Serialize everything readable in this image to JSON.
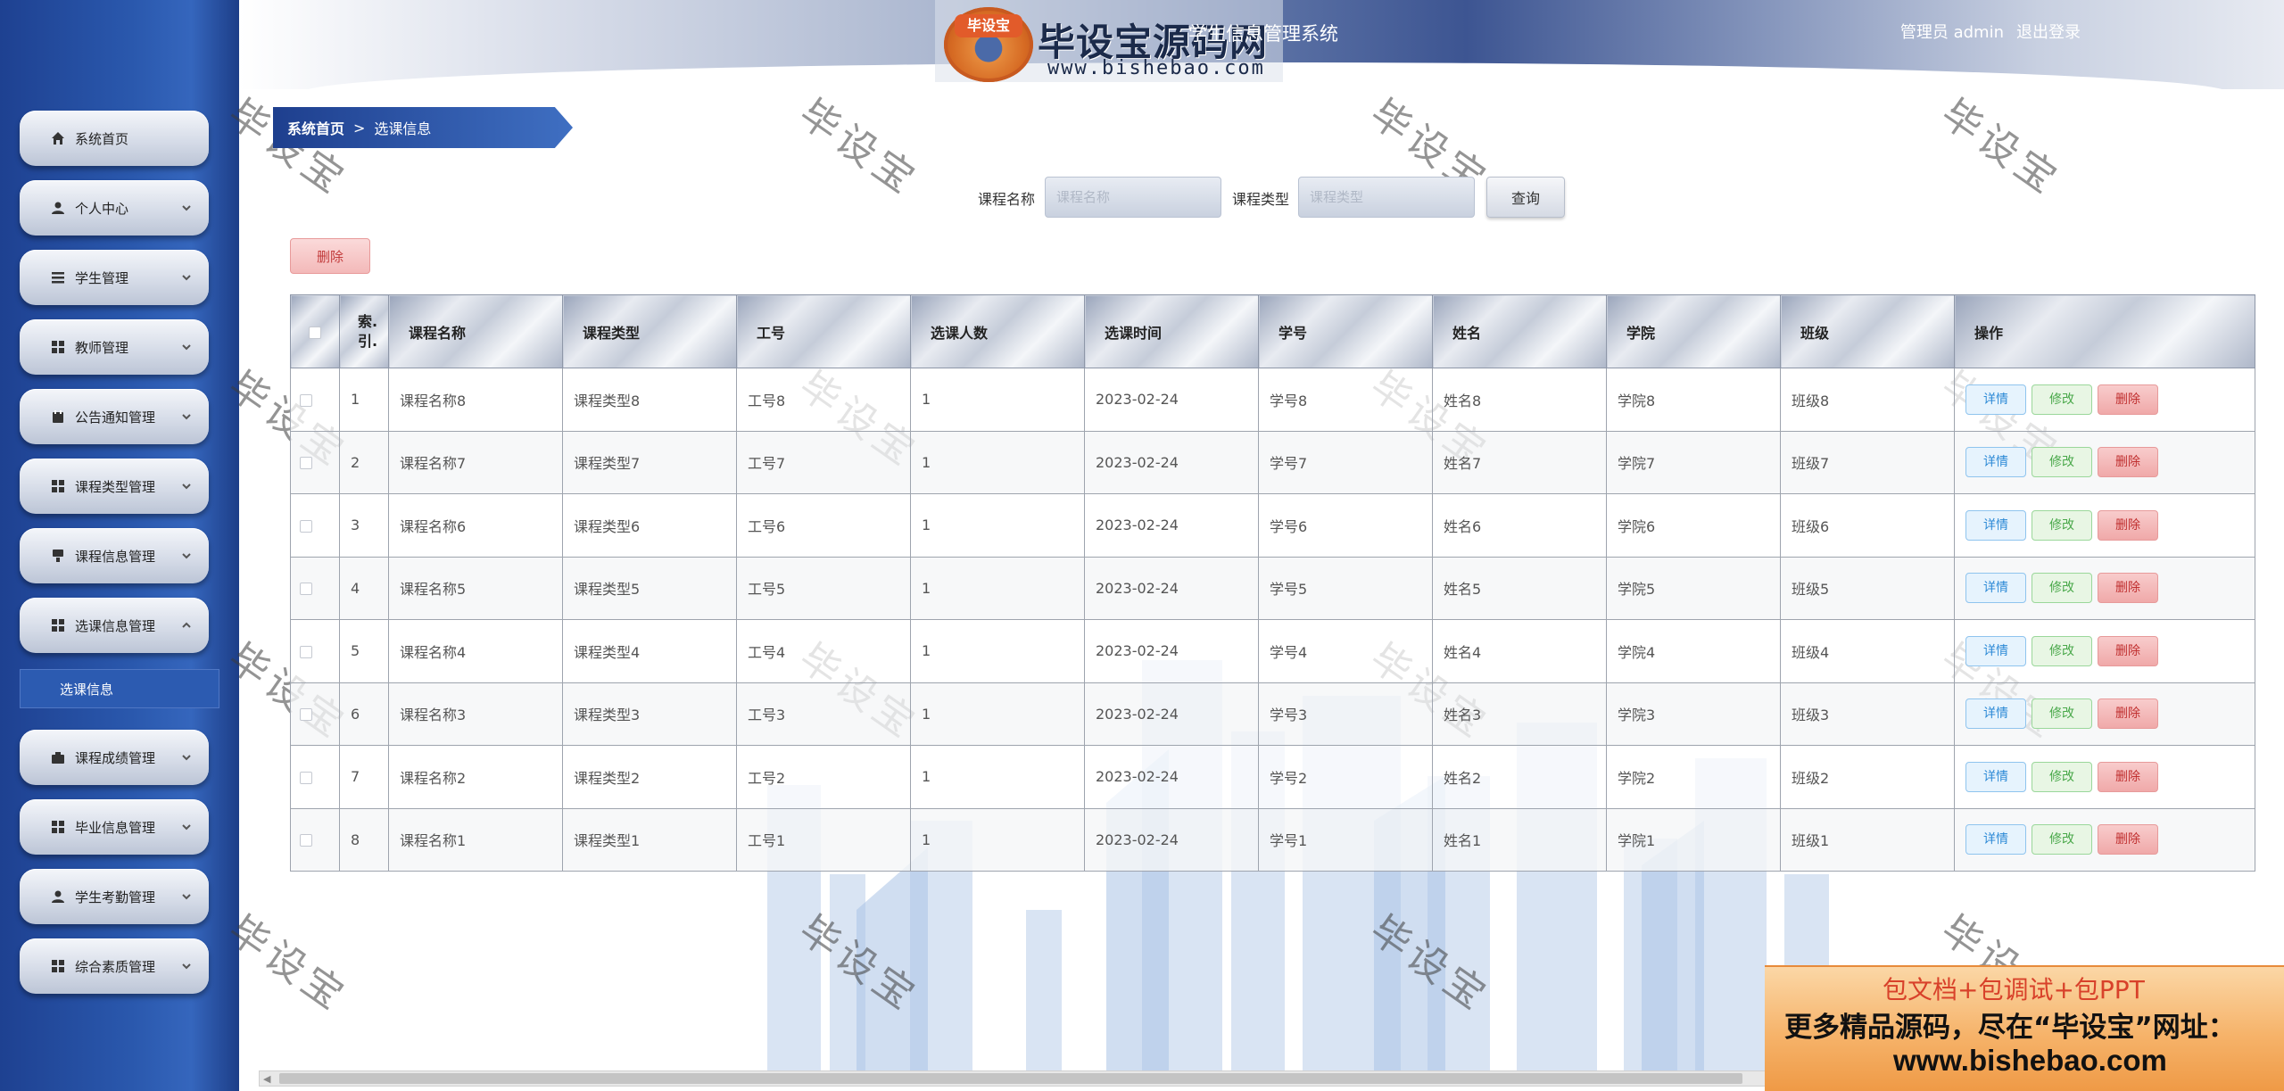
{
  "header": {
    "logo_badge": "毕设宝",
    "logo_title": "毕设宝源码网",
    "logo_url": "www.bishebao.com",
    "system_title": "学生信息管理系统",
    "user_role_label": "管理员 admin",
    "logout_label": "退出登录"
  },
  "sidebar": {
    "items": [
      {
        "label": "系统首页",
        "icon": "home-icon"
      },
      {
        "label": "个人中心",
        "icon": "user-icon"
      },
      {
        "label": "学生管理",
        "icon": "list-icon"
      },
      {
        "label": "教师管理",
        "icon": "grid-icon"
      },
      {
        "label": "公告通知管理",
        "icon": "calendar-icon"
      },
      {
        "label": "课程类型管理",
        "icon": "grid-icon"
      },
      {
        "label": "课程信息管理",
        "icon": "monitor-icon"
      },
      {
        "label": "选课信息管理",
        "icon": "grid-icon"
      },
      {
        "label": "课程成绩管理",
        "icon": "briefcase-icon"
      },
      {
        "label": "毕业信息管理",
        "icon": "grid-icon"
      },
      {
        "label": "学生考勤管理",
        "icon": "user-icon"
      },
      {
        "label": "综合素质管理",
        "icon": "grid-icon"
      }
    ],
    "active_sub_item": "选课信息"
  },
  "breadcrumb": {
    "home": "系统首页",
    "separator": ">",
    "current": "选课信息"
  },
  "search": {
    "course_name_label": "课程名称",
    "course_name_placeholder": "课程名称",
    "course_type_label": "课程类型",
    "course_type_placeholder": "课程类型",
    "query_button": "查询"
  },
  "toolbar": {
    "delete_label": "删除"
  },
  "table": {
    "columns": [
      "",
      "索引",
      "课程名称",
      "课程类型",
      "工号",
      "选课人数",
      "选课时间",
      "学号",
      "姓名",
      "学院",
      "班级",
      "操作"
    ],
    "index_header_line1": "索.",
    "index_header_line2": "引.",
    "rows": [
      {
        "index": "1",
        "course_name": "课程名称8",
        "course_type": "课程类型8",
        "job_no": "工号8",
        "count": "1",
        "time": "2023-02-24",
        "student_no": "学号8",
        "name": "姓名8",
        "college": "学院8",
        "class": "班级8"
      },
      {
        "index": "2",
        "course_name": "课程名称7",
        "course_type": "课程类型7",
        "job_no": "工号7",
        "count": "1",
        "time": "2023-02-24",
        "student_no": "学号7",
        "name": "姓名7",
        "college": "学院7",
        "class": "班级7"
      },
      {
        "index": "3",
        "course_name": "课程名称6",
        "course_type": "课程类型6",
        "job_no": "工号6",
        "count": "1",
        "time": "2023-02-24",
        "student_no": "学号6",
        "name": "姓名6",
        "college": "学院6",
        "class": "班级6"
      },
      {
        "index": "4",
        "course_name": "课程名称5",
        "course_type": "课程类型5",
        "job_no": "工号5",
        "count": "1",
        "time": "2023-02-24",
        "student_no": "学号5",
        "name": "姓名5",
        "college": "学院5",
        "class": "班级5"
      },
      {
        "index": "5",
        "course_name": "课程名称4",
        "course_type": "课程类型4",
        "job_no": "工号4",
        "count": "1",
        "time": "2023-02-24",
        "student_no": "学号4",
        "name": "姓名4",
        "college": "学院4",
        "class": "班级4"
      },
      {
        "index": "6",
        "course_name": "课程名称3",
        "course_type": "课程类型3",
        "job_no": "工号3",
        "count": "1",
        "time": "2023-02-24",
        "student_no": "学号3",
        "name": "姓名3",
        "college": "学院3",
        "class": "班级3"
      },
      {
        "index": "7",
        "course_name": "课程名称2",
        "course_type": "课程类型2",
        "job_no": "工号2",
        "count": "1",
        "time": "2023-02-24",
        "student_no": "学号2",
        "name": "姓名2",
        "college": "学院2",
        "class": "班级2"
      },
      {
        "index": "8",
        "course_name": "课程名称1",
        "course_type": "课程类型1",
        "job_no": "工号1",
        "count": "1",
        "time": "2023-02-24",
        "student_no": "学号1",
        "name": "姓名1",
        "college": "学院1",
        "class": "班级1"
      }
    ],
    "row_actions": {
      "detail": "详情",
      "edit": "修改",
      "delete": "删除"
    }
  },
  "watermark_text": "毕设宝",
  "promo": {
    "line1": "包文档+包调试+包PPT",
    "line2": "更多精品源码，尽在“毕设宝”网址：",
    "line3": "www.bishebao.com"
  },
  "colors": {
    "sidebar_blue": "#2a58ad",
    "delete_red": "#c03030",
    "detail_blue": "#2d8ad6",
    "edit_green": "#49a84a",
    "promo_orange": "#f6b36a"
  }
}
